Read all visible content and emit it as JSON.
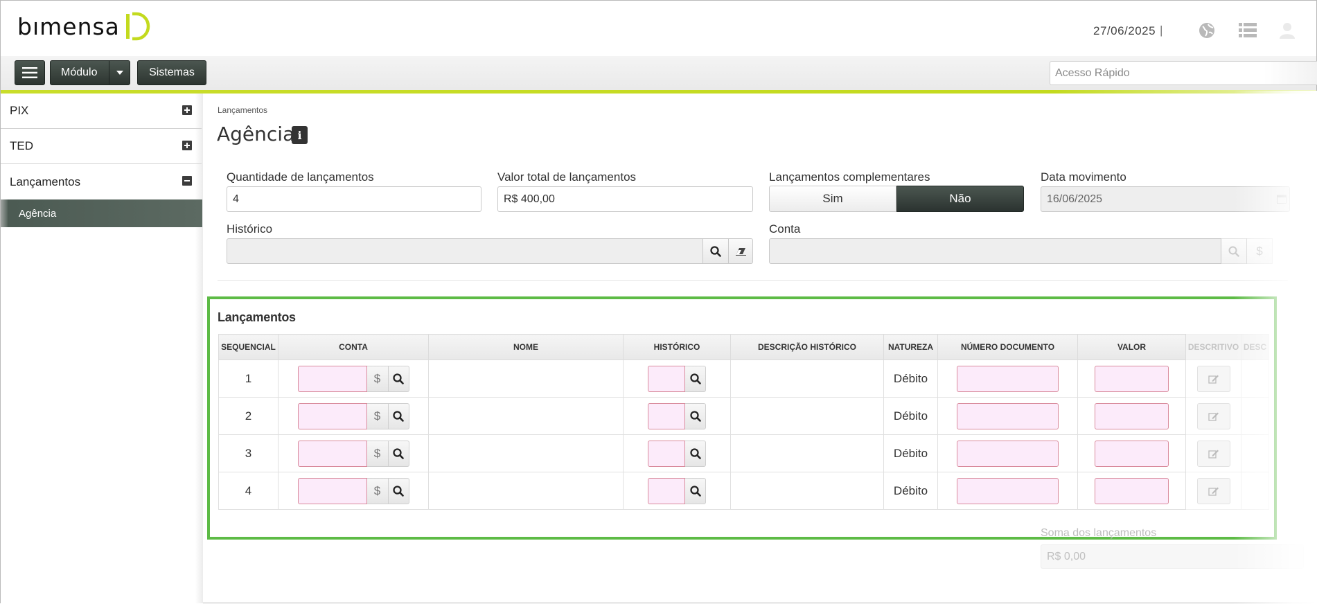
{
  "header": {
    "logo_text": "bımensa",
    "date": "27/06/2025",
    "separator": "|"
  },
  "toolbar": {
    "module_label": "Módulo",
    "systems_label": "Sistemas",
    "quick_access_placeholder": "Acesso Rápido"
  },
  "sidebar": {
    "items": [
      {
        "label": "PIX",
        "toggle": "plus"
      },
      {
        "label": "TED",
        "toggle": "plus"
      },
      {
        "label": "Lançamentos",
        "toggle": "minus"
      }
    ],
    "active_sub": "Agência"
  },
  "breadcrumb": "Lançamentos",
  "page_title": "Agência",
  "info_icon": "i",
  "form": {
    "quantidade": {
      "label": "Quantidade de lançamentos",
      "value": "4"
    },
    "valor_total": {
      "label": "Valor total de lançamentos",
      "value": "R$ 400,00"
    },
    "complementares": {
      "label": "Lançamentos complementares",
      "options": [
        "Sim",
        "Não"
      ],
      "selected": "Não"
    },
    "data_movimento": {
      "label": "Data movimento",
      "value": "16/06/2025"
    },
    "historico": {
      "label": "Histórico",
      "value": ""
    },
    "conta": {
      "label": "Conta",
      "value": ""
    }
  },
  "lancamentos": {
    "title": "Lançamentos",
    "columns": [
      "SEQUENCIAL",
      "CONTA",
      "NOME",
      "HISTÓRICO",
      "DESCRIÇÃO HISTÓRICO",
      "NATUREZA",
      "NÚMERO DOCUMENTO",
      "VALOR",
      "DESCRITIVO",
      "DESC"
    ],
    "currency_symbol": "$",
    "rows": [
      {
        "seq": "1",
        "natureza": "Débito"
      },
      {
        "seq": "2",
        "natureza": "Débito"
      },
      {
        "seq": "3",
        "natureza": "Débito"
      },
      {
        "seq": "4",
        "natureza": "Débito"
      }
    ]
  },
  "soma": {
    "label": "Soma dos lançamentos",
    "value": "R$ 0,00"
  },
  "colors": {
    "accent_green": "#5dbb46",
    "toolbar_line": "#c3da1e",
    "dark_button": "#3a443f",
    "required_field_bg": "#fcebfa",
    "required_field_border": "#d98a9c"
  },
  "icons": [
    "menu-icon",
    "caret-down-icon",
    "globe-icon",
    "list-icon",
    "user-icon",
    "plus-icon",
    "minus-icon",
    "info-icon",
    "search-icon",
    "eraser-icon",
    "dollar-icon",
    "edit-icon",
    "calendar-icon"
  ]
}
